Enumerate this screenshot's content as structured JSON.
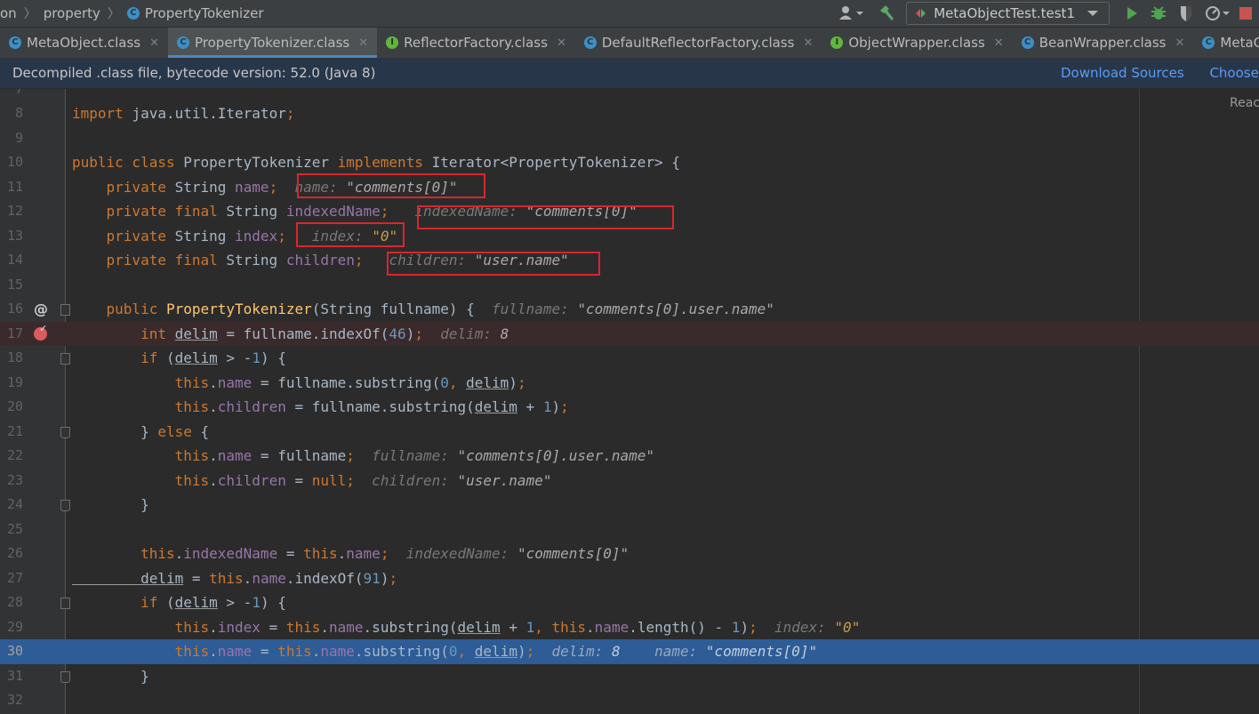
{
  "navbar": {
    "breadcrumb": [
      "on",
      "property",
      "PropertyTokenizer"
    ],
    "run_config": "MetaObjectTest.test1"
  },
  "tabs": [
    {
      "label": "MetaObject.class",
      "icon": "class-icon",
      "active": false
    },
    {
      "label": "PropertyTokenizer.class",
      "icon": "class-icon",
      "active": true
    },
    {
      "label": "ReflectorFactory.class",
      "icon": "interface-icon",
      "active": false
    },
    {
      "label": "DefaultReflectorFactory.class",
      "icon": "class-icon",
      "active": false
    },
    {
      "label": "ObjectWrapper.class",
      "icon": "interface-icon",
      "active": false
    },
    {
      "label": "BeanWrapper.class",
      "icon": "class-icon",
      "active": false
    },
    {
      "label": "MetaC",
      "icon": "class-icon",
      "active": false
    }
  ],
  "banner": {
    "message": "Decompiled .class file, bytecode version: 52.0 (Java 8)",
    "download_sources": "Download Sources",
    "choose_sources": "Choose S"
  },
  "editor": {
    "reader_mode": "Reac",
    "top_partial_line": "7",
    "lines": [
      {
        "num": "8",
        "parts": [
          [
            "kw",
            "import "
          ],
          [
            "",
            "java.util.Iterator"
          ],
          [
            "kw",
            ";"
          ]
        ]
      },
      {
        "num": "9",
        "parts": []
      },
      {
        "num": "10",
        "parts": [
          [
            "kw",
            "public class "
          ],
          [
            "",
            "PropertyTokenizer "
          ],
          [
            "kw",
            "implements "
          ],
          [
            "",
            "Iterator<PropertyTokenizer> {"
          ]
        ]
      },
      {
        "num": "11",
        "parts": [
          [
            "kw",
            "    private "
          ],
          [
            "",
            "String "
          ],
          [
            "fld",
            "name"
          ],
          [
            "kw",
            ";"
          ],
          [
            "",
            "  "
          ],
          [
            "ih",
            "name: "
          ],
          [
            "ihv",
            "\"comments[0]\""
          ]
        ]
      },
      {
        "num": "12",
        "parts": [
          [
            "kw",
            "    private final "
          ],
          [
            "",
            "String "
          ],
          [
            "fld",
            "indexedName"
          ],
          [
            "kw",
            ";"
          ],
          [
            "",
            "   "
          ],
          [
            "ih",
            "indexedName: "
          ],
          [
            "ihv",
            "\"comments[0]\""
          ]
        ]
      },
      {
        "num": "13",
        "parts": [
          [
            "kw",
            "    private "
          ],
          [
            "",
            "String "
          ],
          [
            "fld",
            "index"
          ],
          [
            "kw",
            ";"
          ],
          [
            "",
            "   "
          ],
          [
            "ih",
            "index: "
          ],
          [
            "ihn",
            "\"0\""
          ]
        ]
      },
      {
        "num": "14",
        "parts": [
          [
            "kw",
            "    private final "
          ],
          [
            "",
            "String "
          ],
          [
            "fld",
            "children"
          ],
          [
            "kw",
            ";"
          ],
          [
            "",
            "   "
          ],
          [
            "ih",
            "children: "
          ],
          [
            "ihv",
            "\"user.name\""
          ]
        ]
      },
      {
        "num": "15",
        "parts": []
      },
      {
        "num": "16",
        "parts": [
          [
            "kw",
            "    public "
          ],
          [
            "mth",
            "PropertyTokenizer"
          ],
          [
            "",
            "(String fullname) {  "
          ],
          [
            "ih",
            "fullname: "
          ],
          [
            "ihv",
            "\"comments[0].user.name\""
          ]
        ]
      },
      {
        "num": "17",
        "parts": [
          [
            "kw",
            "        int "
          ],
          [
            "ul",
            "delim"
          ],
          [
            "",
            " = fullname.indexOf("
          ],
          [
            "num",
            "46"
          ],
          [
            "",
            ")"
          ],
          [
            "kw",
            ";"
          ],
          [
            "",
            "  "
          ],
          [
            "ih",
            "delim: "
          ],
          [
            "ihv",
            "8"
          ]
        ]
      },
      {
        "num": "18",
        "parts": [
          [
            "kw",
            "        if "
          ],
          [
            "",
            "("
          ],
          [
            "ul",
            "delim"
          ],
          [
            "",
            " > -"
          ],
          [
            "num",
            "1"
          ],
          [
            "",
            ") {"
          ]
        ]
      },
      {
        "num": "19",
        "parts": [
          [
            "kw",
            "            this"
          ],
          [
            "",
            "."
          ],
          [
            "fld",
            "name"
          ],
          [
            "",
            " = fullname.substring("
          ],
          [
            "num",
            "0"
          ],
          [
            "kw",
            ", "
          ],
          [
            "ul",
            "delim"
          ],
          [
            "",
            ")"
          ],
          [
            "kw",
            ";"
          ]
        ]
      },
      {
        "num": "20",
        "parts": [
          [
            "kw",
            "            this"
          ],
          [
            "",
            "."
          ],
          [
            "fld",
            "children"
          ],
          [
            "",
            " = fullname.substring("
          ],
          [
            "ul",
            "delim"
          ],
          [
            "",
            " + "
          ],
          [
            "num",
            "1"
          ],
          [
            "",
            ")"
          ],
          [
            "kw",
            ";"
          ]
        ]
      },
      {
        "num": "21",
        "parts": [
          [
            "",
            "        } "
          ],
          [
            "kw",
            "else "
          ],
          [
            "",
            "{"
          ]
        ]
      },
      {
        "num": "22",
        "parts": [
          [
            "kw",
            "            this"
          ],
          [
            "",
            "."
          ],
          [
            "fld",
            "name"
          ],
          [
            "",
            " = fullname"
          ],
          [
            "kw",
            ";"
          ],
          [
            "",
            "  "
          ],
          [
            "ih",
            "fullname: "
          ],
          [
            "ihv",
            "\"comments[0].user.name\""
          ]
        ]
      },
      {
        "num": "23",
        "parts": [
          [
            "kw",
            "            this"
          ],
          [
            "",
            "."
          ],
          [
            "fld",
            "children"
          ],
          [
            "",
            " = "
          ],
          [
            "kw",
            "null;"
          ],
          [
            "",
            "  "
          ],
          [
            "ih",
            "children: "
          ],
          [
            "ihv",
            "\"user.name\""
          ]
        ]
      },
      {
        "num": "24",
        "parts": [
          [
            "",
            "        }"
          ]
        ]
      },
      {
        "num": "25",
        "parts": []
      },
      {
        "num": "26",
        "parts": [
          [
            "kw",
            "        this"
          ],
          [
            "",
            "."
          ],
          [
            "fld",
            "indexedName"
          ],
          [
            "",
            " = "
          ],
          [
            "kw",
            "this"
          ],
          [
            "",
            "."
          ],
          [
            "fld",
            "name"
          ],
          [
            "kw",
            ";"
          ],
          [
            "",
            "  "
          ],
          [
            "ih",
            "indexedName: "
          ],
          [
            "ihv",
            "\"comments[0]\""
          ]
        ]
      },
      {
        "num": "27",
        "parts": [
          [
            "ul",
            "        delim"
          ],
          [
            "",
            " = "
          ],
          [
            "kw",
            "this"
          ],
          [
            "",
            "."
          ],
          [
            "fld",
            "name"
          ],
          [
            "",
            ".indexOf("
          ],
          [
            "num",
            "91"
          ],
          [
            "",
            ")"
          ],
          [
            "kw",
            ";"
          ]
        ]
      },
      {
        "num": "28",
        "parts": [
          [
            "kw",
            "        if "
          ],
          [
            "",
            "("
          ],
          [
            "ul",
            "delim"
          ],
          [
            "",
            " > -"
          ],
          [
            "num",
            "1"
          ],
          [
            "",
            ") {"
          ]
        ]
      },
      {
        "num": "29",
        "parts": [
          [
            "kw",
            "            this"
          ],
          [
            "",
            "."
          ],
          [
            "fld",
            "index"
          ],
          [
            "",
            " = "
          ],
          [
            "kw",
            "this"
          ],
          [
            "",
            "."
          ],
          [
            "fld",
            "name"
          ],
          [
            "",
            ".substring("
          ],
          [
            "ul",
            "delim"
          ],
          [
            "",
            " + "
          ],
          [
            "num",
            "1"
          ],
          [
            "kw",
            ", this"
          ],
          [
            "",
            "."
          ],
          [
            "fld",
            "name"
          ],
          [
            "",
            ".length() - "
          ],
          [
            "num",
            "1"
          ],
          [
            "",
            ")"
          ],
          [
            "kw",
            ";"
          ],
          [
            "",
            "  "
          ],
          [
            "ih",
            "index: "
          ],
          [
            "ihn",
            "\"0\""
          ]
        ]
      },
      {
        "num": "30",
        "parts": [
          [
            "kw",
            "            this"
          ],
          [
            "",
            "."
          ],
          [
            "fld",
            "name"
          ],
          [
            "",
            " = "
          ],
          [
            "kw",
            "this"
          ],
          [
            "",
            "."
          ],
          [
            "fld",
            "name"
          ],
          [
            "",
            ".substring("
          ],
          [
            "num",
            "0"
          ],
          [
            "kw",
            ", "
          ],
          [
            "ul",
            "delim"
          ],
          [
            "",
            ")"
          ],
          [
            "kw",
            ";"
          ],
          [
            "",
            "  "
          ],
          [
            "ih",
            "delim: "
          ],
          [
            "ihv",
            "8"
          ],
          [
            "",
            "    "
          ],
          [
            "ih",
            "name: "
          ],
          [
            "ihv",
            "\"comments[0]\""
          ]
        ]
      },
      {
        "num": "31",
        "parts": [
          [
            "",
            "        }"
          ]
        ]
      },
      {
        "num": "32",
        "parts": []
      }
    ]
  }
}
